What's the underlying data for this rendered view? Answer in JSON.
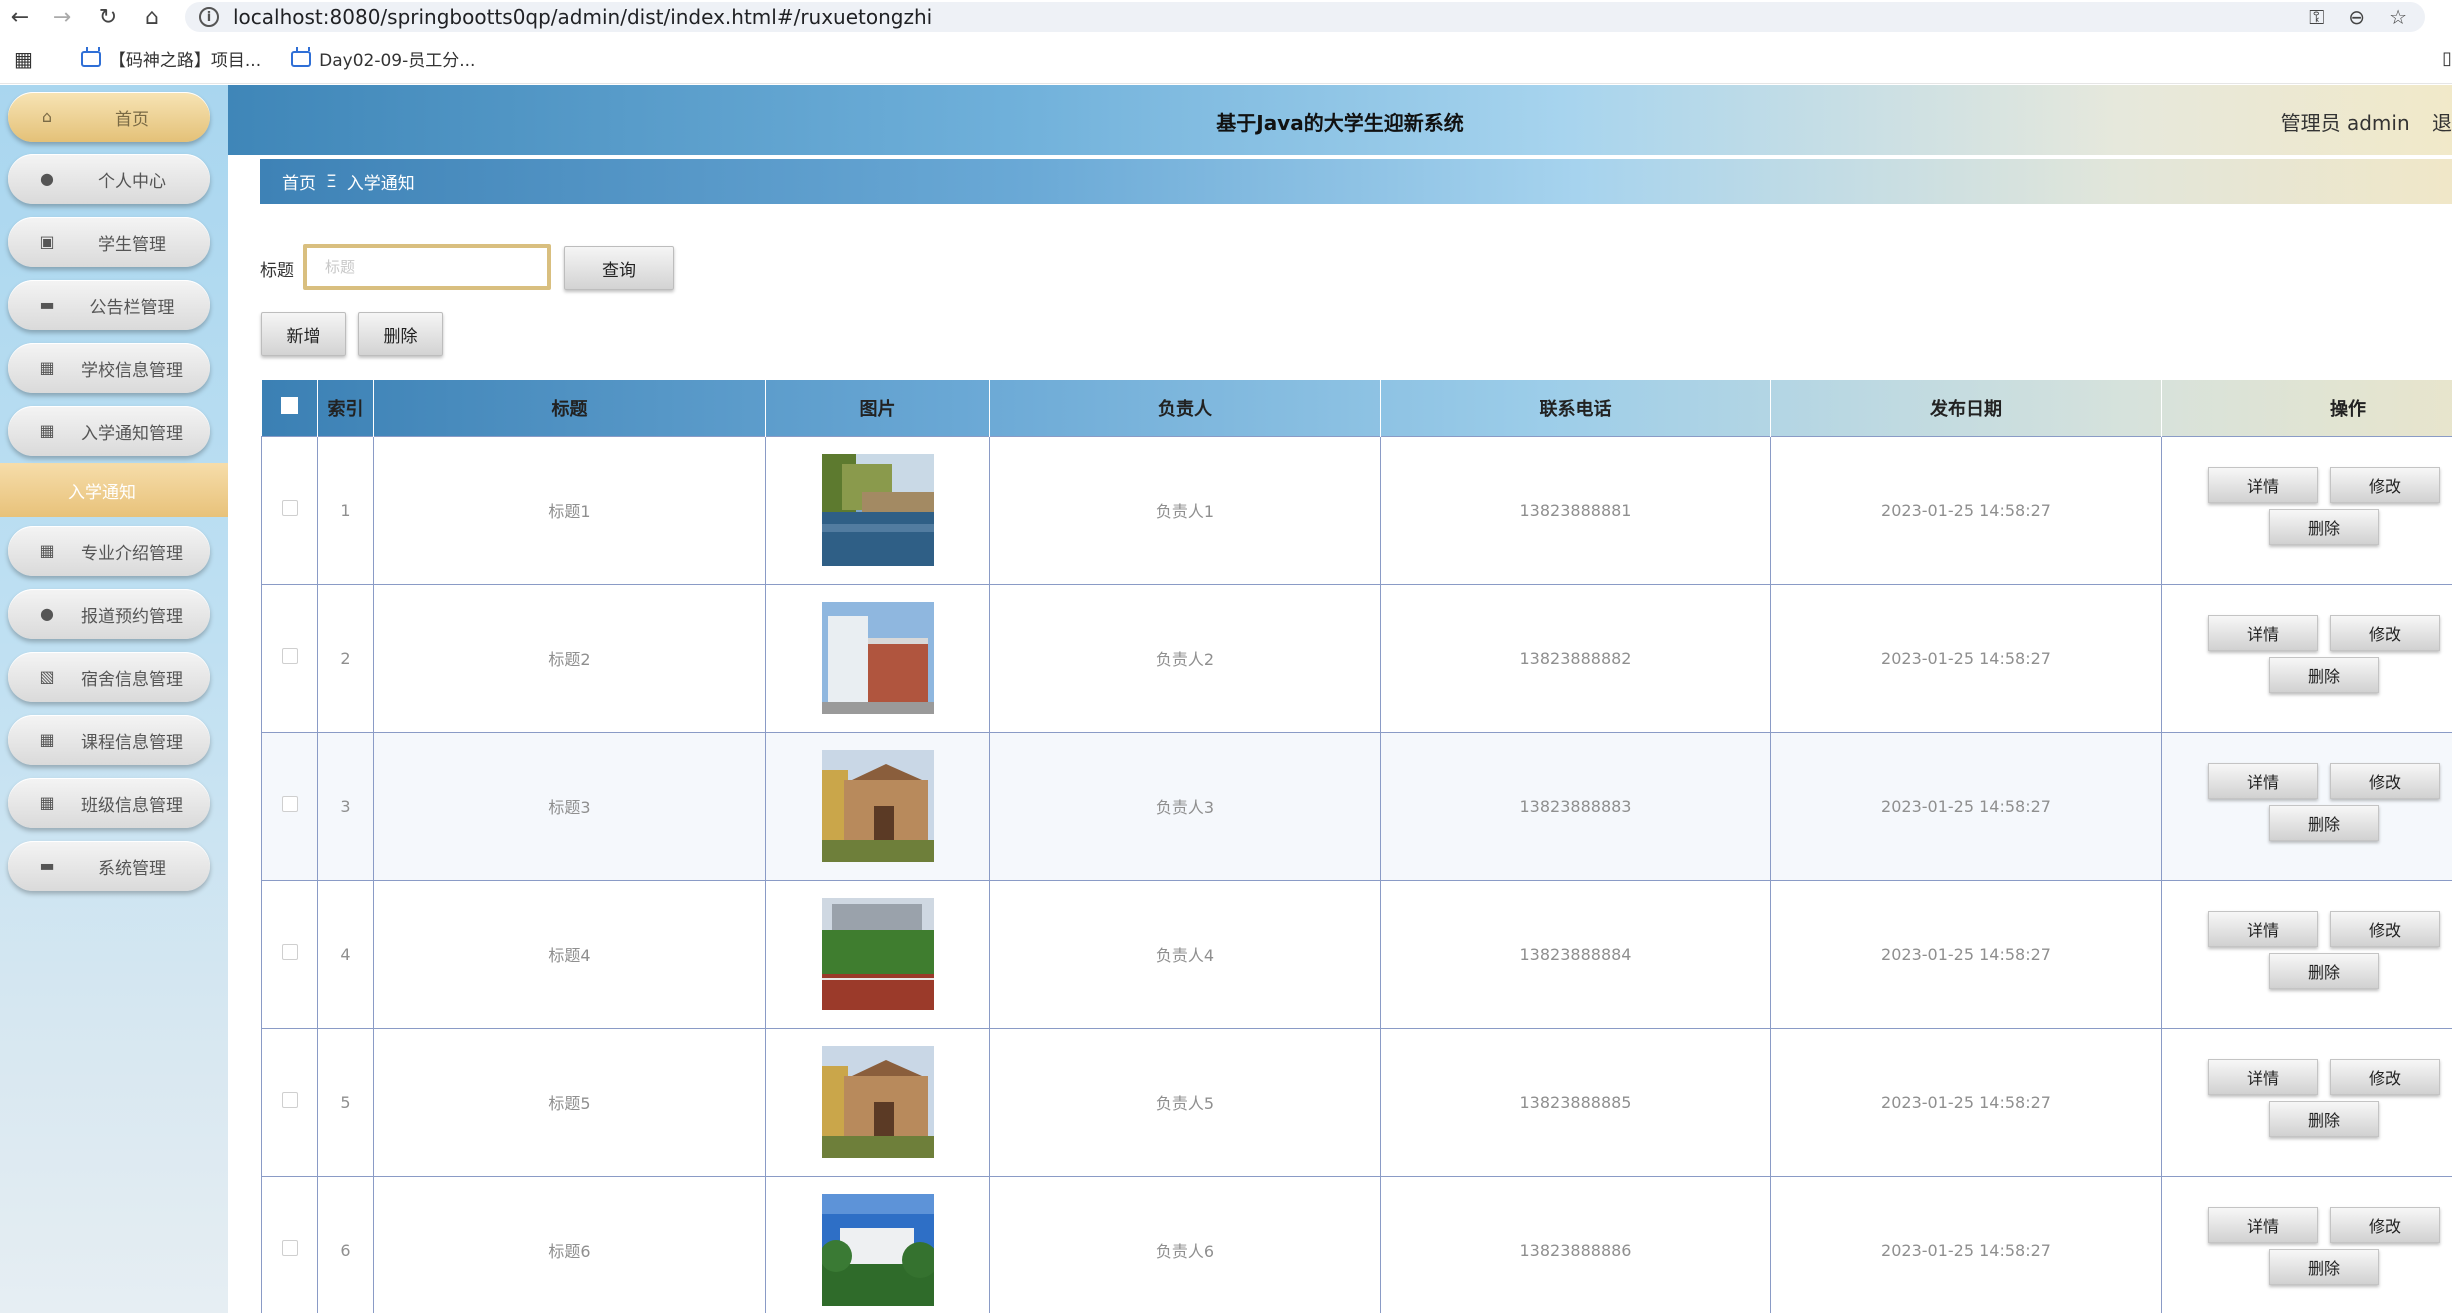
{
  "browser": {
    "url": "localhost:8080/springbootts0qp/admin/dist/index.html#/ruxuetongzhi",
    "bookmarks": [
      "【码神之路】项目...",
      "Day02-09-员工分..."
    ]
  },
  "app": {
    "title": "基于Java的大学生迎新系统",
    "user": "管理员 admin",
    "logout": "退"
  },
  "sidebar": {
    "items": [
      {
        "label": "首页",
        "icon": "home-icon",
        "glyph": "⌂"
      },
      {
        "label": "个人中心",
        "icon": "user-icon",
        "glyph": "●"
      },
      {
        "label": "学生管理",
        "icon": "chart-icon",
        "glyph": "▣"
      },
      {
        "label": "公告栏管理",
        "icon": "monitor-icon",
        "glyph": "▬"
      },
      {
        "label": "学校信息管理",
        "icon": "grid-icon",
        "glyph": "▦"
      },
      {
        "label": "入学通知管理",
        "icon": "grid-icon",
        "glyph": "▦"
      },
      {
        "label": "专业介绍管理",
        "icon": "grid-icon",
        "glyph": "▦"
      },
      {
        "label": "报道预约管理",
        "icon": "user-icon",
        "glyph": "●"
      },
      {
        "label": "宿舍信息管理",
        "icon": "clipboard-icon",
        "glyph": "▧"
      },
      {
        "label": "课程信息管理",
        "icon": "grid-icon",
        "glyph": "▦"
      },
      {
        "label": "班级信息管理",
        "icon": "grid-icon",
        "glyph": "▦"
      },
      {
        "label": "系统管理",
        "icon": "briefcase-icon",
        "glyph": "▬"
      }
    ],
    "active_sub": "入学通知"
  },
  "breadcrumb": {
    "home": "首页",
    "sep": "Ξ",
    "current": "入学通知"
  },
  "search": {
    "label": "标题",
    "placeholder": "标题",
    "query_label": "查询"
  },
  "toolbar": {
    "add_label": "新增",
    "delete_label": "删除"
  },
  "table": {
    "headers": [
      "索引",
      "标题",
      "图片",
      "负责人",
      "联系电话",
      "发布日期",
      "操作"
    ],
    "actions": {
      "detail": "详情",
      "edit": "修改",
      "delete": "删除"
    },
    "rows": [
      {
        "index": "1",
        "title": "标题1",
        "owner": "负责人1",
        "phone": "13823888881",
        "date": "2023-01-25 14:58:27",
        "image": "lake"
      },
      {
        "index": "2",
        "title": "标题2",
        "owner": "负责人2",
        "phone": "13823888882",
        "date": "2023-01-25 14:58:27",
        "image": "building"
      },
      {
        "index": "3",
        "title": "标题3",
        "owner": "负责人3",
        "phone": "13823888883",
        "date": "2023-01-25 14:58:27",
        "image": "hall"
      },
      {
        "index": "4",
        "title": "标题4",
        "owner": "负责人4",
        "phone": "13823888884",
        "date": "2023-01-25 14:58:27",
        "image": "field"
      },
      {
        "index": "5",
        "title": "标题5",
        "owner": "负责人5",
        "phone": "13823888885",
        "date": "2023-01-25 14:58:27",
        "image": "hall"
      },
      {
        "index": "6",
        "title": "标题6",
        "owner": "负责人6",
        "phone": "13823888886",
        "date": "2023-01-25 14:58:27",
        "image": "campus"
      }
    ]
  }
}
